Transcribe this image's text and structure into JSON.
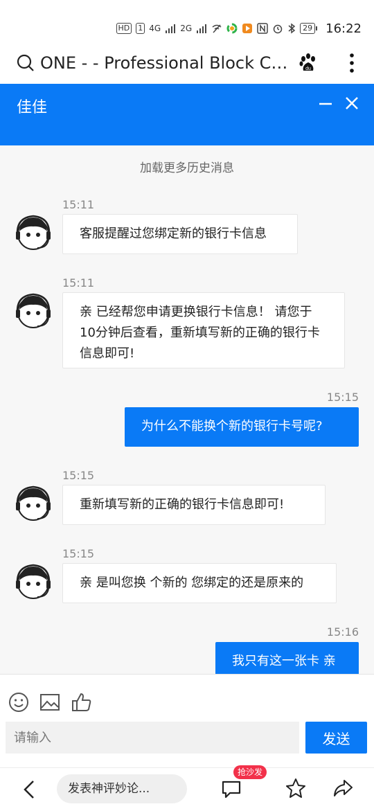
{
  "status_bar": {
    "hd": "HD",
    "sim1": "1",
    "net1": "4G",
    "net2": "2G",
    "battery": "29",
    "time": "16:22"
  },
  "browser": {
    "title": "ONE - - Professional Block Ch...",
    "baidu_icon": "baidu-paw-icon",
    "more_icon": "more-vertical-icon"
  },
  "chat_header": {
    "agent_name": "佳佳",
    "accent": "#0a7af6"
  },
  "chat": {
    "load_more": "加载更多历史消息",
    "messages": [
      {
        "time": "15:11",
        "text": "客服提醒过您绑定新的银行卡信息"
      },
      {
        "time": "15:11",
        "text": "亲 已经帮您申请更换银行卡信息！ 请您于10分钟后查看，重新填写新的正确的银行卡信息即可!"
      },
      {
        "time": "15:15",
        "text": "为什么不能换个新的银行卡号呢?"
      },
      {
        "time": "15:15",
        "text": "重新填写新的正确的银行卡信息即可!"
      },
      {
        "time": "15:15",
        "text": "亲 是叫您换 个新的 您绑定的还是原来的"
      },
      {
        "time": "15:16",
        "text": "我只有这一张卡 亲"
      }
    ]
  },
  "input": {
    "placeholder": "请输入",
    "send_label": "发送"
  },
  "bottom_nav": {
    "comment_placeholder": "发表神评妙论...",
    "sofa_badge": "抢沙发"
  }
}
